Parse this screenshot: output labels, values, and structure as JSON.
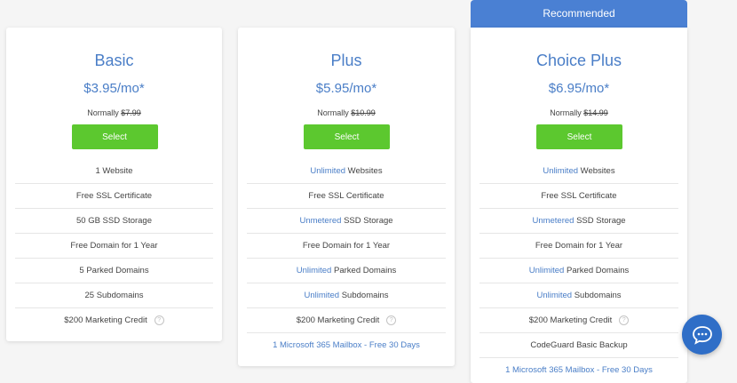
{
  "recommended_label": "Recommended",
  "plans": {
    "basic": {
      "name": "Basic",
      "price": "$3.95/mo*",
      "normally_label": "Normally",
      "normally_price": "$7.99",
      "select_label": "Select",
      "features": [
        {
          "pre": "",
          "hl": "",
          "post": "1 Website"
        },
        {
          "pre": "",
          "hl": "",
          "post": "Free SSL Certificate"
        },
        {
          "pre": "",
          "hl": "",
          "post": "50 GB SSD Storage"
        },
        {
          "pre": "",
          "hl": "",
          "post": "Free Domain for 1 Year"
        },
        {
          "pre": "",
          "hl": "",
          "post": "5 Parked Domains"
        },
        {
          "pre": "",
          "hl": "",
          "post": "25 Subdomains"
        },
        {
          "pre": "",
          "hl": "",
          "post": "$200 Marketing Credit",
          "help": "?"
        }
      ]
    },
    "plus": {
      "name": "Plus",
      "price": "$5.95/mo*",
      "normally_label": "Normally",
      "normally_price": "$10.99",
      "select_label": "Select",
      "features": [
        {
          "hl": "Unlimited",
          "post": " Websites"
        },
        {
          "hl": "",
          "post": "Free SSL Certificate"
        },
        {
          "hl": "Unmetered",
          "post": " SSD Storage"
        },
        {
          "hl": "",
          "post": "Free Domain for 1 Year"
        },
        {
          "hl": "Unlimited",
          "post": " Parked Domains"
        },
        {
          "hl": "Unlimited",
          "post": " Subdomains"
        },
        {
          "hl": "",
          "post": "$200 Marketing Credit",
          "help": "?"
        },
        {
          "link": "1 Microsoft 365 Mailbox - Free 30 Days"
        }
      ]
    },
    "choice_plus": {
      "name": "Choice Plus",
      "price": "$6.95/mo*",
      "normally_label": "Normally",
      "normally_price": "$14.99",
      "select_label": "Select",
      "features": [
        {
          "hl": "Unlimited",
          "post": " Websites"
        },
        {
          "hl": "",
          "post": "Free SSL Certificate"
        },
        {
          "hl": "Unmetered",
          "post": " SSD Storage"
        },
        {
          "hl": "",
          "post": "Free Domain for 1 Year"
        },
        {
          "hl": "Unlimited",
          "post": " Parked Domains"
        },
        {
          "hl": "Unlimited",
          "post": " Subdomains"
        },
        {
          "hl": "",
          "post": "$200 Marketing Credit",
          "help": "?"
        },
        {
          "hl": "",
          "post": "CodeGuard Basic Backup"
        },
        {
          "link": "1 Microsoft 365 Mailbox - Free 30 Days"
        }
      ]
    }
  },
  "chat": {
    "icon": "chat-bubble-icon",
    "color": "#2f6ec7"
  },
  "colors": {
    "accent": "#4a7ec7",
    "select": "#5cc82f",
    "banner": "#4a80d3"
  }
}
